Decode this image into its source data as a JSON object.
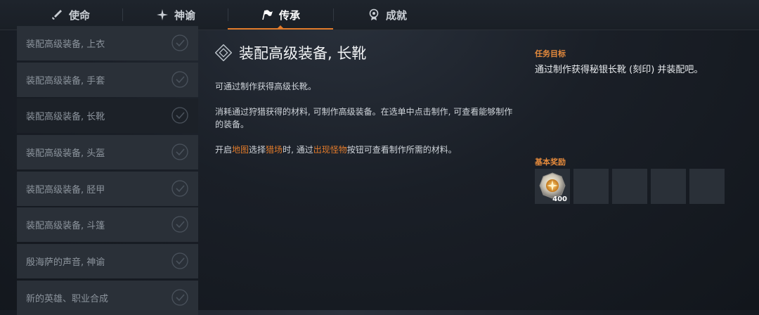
{
  "tabs": [
    {
      "label": "使命",
      "icon": "sword-icon",
      "active": false
    },
    {
      "label": "神谕",
      "icon": "star-burst-icon",
      "active": false
    },
    {
      "label": "传承",
      "icon": "flag-icon",
      "active": true
    },
    {
      "label": "成就",
      "icon": "medal-icon",
      "active": false
    }
  ],
  "quests": [
    {
      "label": "装配高级装备, 上衣",
      "completed": true
    },
    {
      "label": "装配高级装备, 手套",
      "completed": true
    },
    {
      "label": "装配高级装备, 长靴",
      "completed": true,
      "selected": true
    },
    {
      "label": "装配高级装备, 头盔",
      "completed": true
    },
    {
      "label": "装配高级装备, 胫甲",
      "completed": true
    },
    {
      "label": "装配高级装备, 斗篷",
      "completed": true
    },
    {
      "label": "殷海萨的声音, 神谕",
      "completed": true
    },
    {
      "label": "新的英雄、职业合成",
      "completed": true
    }
  ],
  "detail": {
    "title": "装配高级装备, 长靴",
    "icon": "quest-diamond-icon",
    "para1": "可通过制作获得高级长靴。",
    "para2": "消耗通过狩猎获得的材料, 可制作高级装备。在选单中点击制作, 可查看能够制作的装备。",
    "para3": {
      "t1": "开启",
      "link1": "地图",
      "t2": "选择",
      "link2": "猎场",
      "t3": "时, 通过",
      "link3": "出现怪物",
      "t4": "按钮可查看制作所需的材料。"
    }
  },
  "objective": {
    "label": "任务目标",
    "text": "通过制作获得秘银长靴 (刻印) 并装配吧。"
  },
  "rewards": {
    "label": "基本奖励",
    "items": [
      {
        "icon": "gold-coin-icon",
        "count": "400"
      },
      {
        "icon": "",
        "count": ""
      },
      {
        "icon": "",
        "count": ""
      },
      {
        "icon": "",
        "count": ""
      },
      {
        "icon": "",
        "count": ""
      }
    ]
  },
  "colors": {
    "accent": "#e07a2b",
    "panel": "#2a3038",
    "selected": "#1c2128"
  }
}
